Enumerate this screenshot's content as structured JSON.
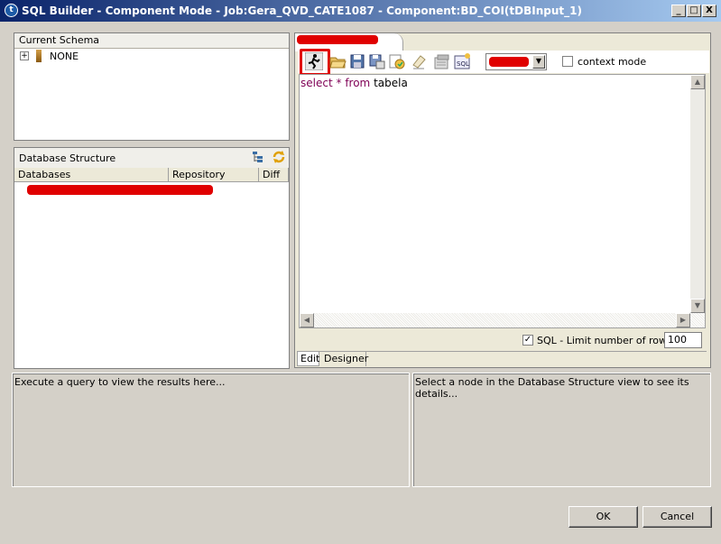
{
  "window": {
    "title": "SQL Builder - Component Mode - Job:Gera_QVD_CATE1087 - Component:BD_COI(tDBInput_1)",
    "controls": [
      "_",
      "□",
      "X"
    ]
  },
  "schema_panel": {
    "title": "Current Schema",
    "tree_item": "NONE"
  },
  "db_panel": {
    "title": "Database Structure",
    "columns": [
      "Databases",
      "Repository",
      "Diff"
    ]
  },
  "editor": {
    "context_mode_label": "context mode",
    "sql": {
      "kw1": "select",
      "star": "*",
      "kw2": "from",
      "table": "tabela"
    },
    "limit_label": "SQL - Limit number of rows:",
    "limit_value": "100",
    "tabs": [
      "Edit",
      "Designer"
    ]
  },
  "results": {
    "text": "Execute a query to view the results here..."
  },
  "details": {
    "text": "Select a node in the Database Structure view to see its details..."
  },
  "buttons": {
    "ok": "OK",
    "cancel": "Cancel"
  },
  "colors": {
    "title_start": "#0a246a",
    "title_end": "#a6caf0",
    "redaction": "#e00000",
    "sql_keyword": "#7f0055",
    "sql_star": "#7f0055",
    "window_bg": "#d4d0c8"
  },
  "icons": [
    "execute-icon",
    "open-folder-icon",
    "save-icon",
    "save-as-icon",
    "refresh-icon",
    "eraser-icon",
    "export-icon",
    "sql-icon",
    "tree-icon",
    "sync-icon",
    "plus-icon",
    "column-icon"
  ]
}
